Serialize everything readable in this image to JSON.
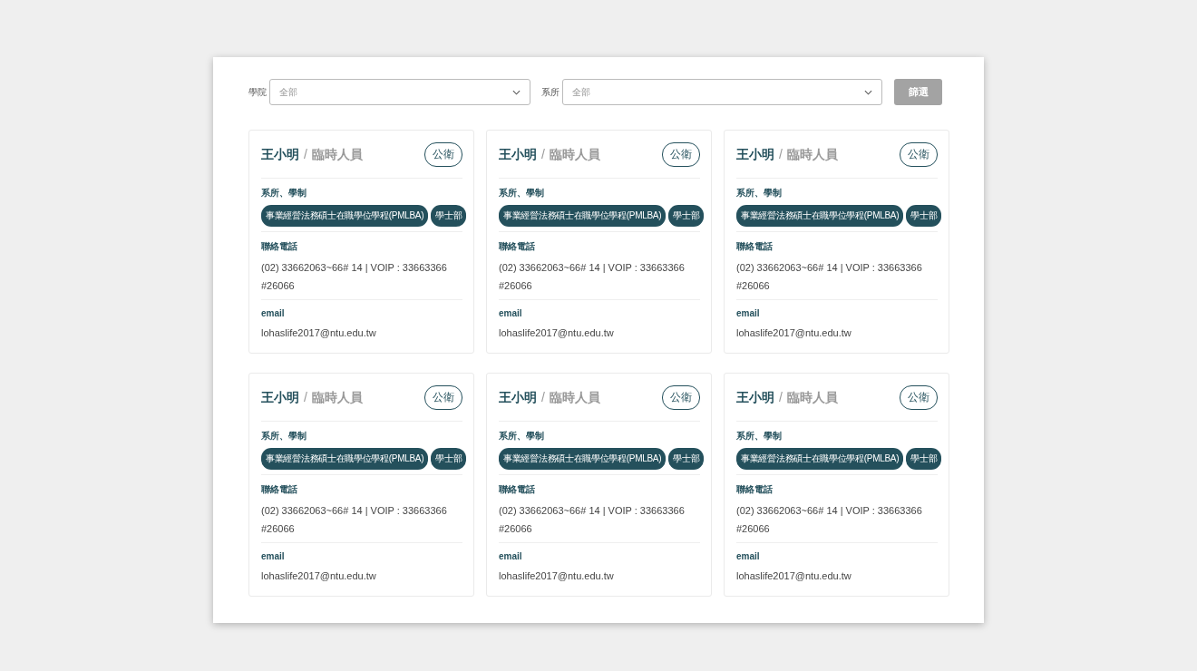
{
  "filters": [
    {
      "label": "學院",
      "placeholder": "全部"
    },
    {
      "label": "系所",
      "placeholder": "全部"
    }
  ],
  "filter_button": "篩選",
  "cards": [
    {
      "name": "王小明",
      "separator": "/",
      "role": "臨時人員",
      "tag": "公衛",
      "dept_label": "系所、學制",
      "programs": [
        "事業經營法務碩士在職學位學程(PMLBA)",
        "學士部"
      ],
      "phone_label": "聯絡電話",
      "phone": "(02) 33662063~66# 14 | VOIP : 33663366 #26066",
      "email_label": "email",
      "email": "lohaslife2017@ntu.edu.tw"
    },
    {
      "name": "王小明",
      "separator": "/",
      "role": "臨時人員",
      "tag": "公衛",
      "dept_label": "系所、學制",
      "programs": [
        "事業經營法務碩士在職學位學程(PMLBA)",
        "學士部"
      ],
      "phone_label": "聯絡電話",
      "phone": "(02) 33662063~66# 14 | VOIP : 33663366 #26066",
      "email_label": "email",
      "email": "lohaslife2017@ntu.edu.tw"
    },
    {
      "name": "王小明",
      "separator": "/",
      "role": "臨時人員",
      "tag": "公衛",
      "dept_label": "系所、學制",
      "programs": [
        "事業經營法務碩士在職學位學程(PMLBA)",
        "學士部"
      ],
      "phone_label": "聯絡電話",
      "phone": "(02) 33662063~66# 14 | VOIP : 33663366 #26066",
      "email_label": "email",
      "email": "lohaslife2017@ntu.edu.tw"
    },
    {
      "name": "王小明",
      "separator": "/",
      "role": "臨時人員",
      "tag": "公衛",
      "dept_label": "系所、學制",
      "programs": [
        "事業經營法務碩士在職學位學程(PMLBA)",
        "學士部"
      ],
      "phone_label": "聯絡電話",
      "phone": "(02) 33662063~66# 14 | VOIP : 33663366 #26066",
      "email_label": "email",
      "email": "lohaslife2017@ntu.edu.tw"
    },
    {
      "name": "王小明",
      "separator": "/",
      "role": "臨時人員",
      "tag": "公衛",
      "dept_label": "系所、學制",
      "programs": [
        "事業經營法務碩士在職學位學程(PMLBA)",
        "學士部"
      ],
      "phone_label": "聯絡電話",
      "phone": "(02) 33662063~66# 14 | VOIP : 33663366 #26066",
      "email_label": "email",
      "email": "lohaslife2017@ntu.edu.tw"
    },
    {
      "name": "王小明",
      "separator": "/",
      "role": "臨時人員",
      "tag": "公衛",
      "dept_label": "系所、學制",
      "programs": [
        "事業經營法務碩士在職學位學程(PMLBA)",
        "學士部"
      ],
      "phone_label": "聯絡電話",
      "phone": "(02) 33662063~66# 14 | VOIP : 33663366 #26066",
      "email_label": "email",
      "email": "lohaslife2017@ntu.edu.tw"
    }
  ]
}
